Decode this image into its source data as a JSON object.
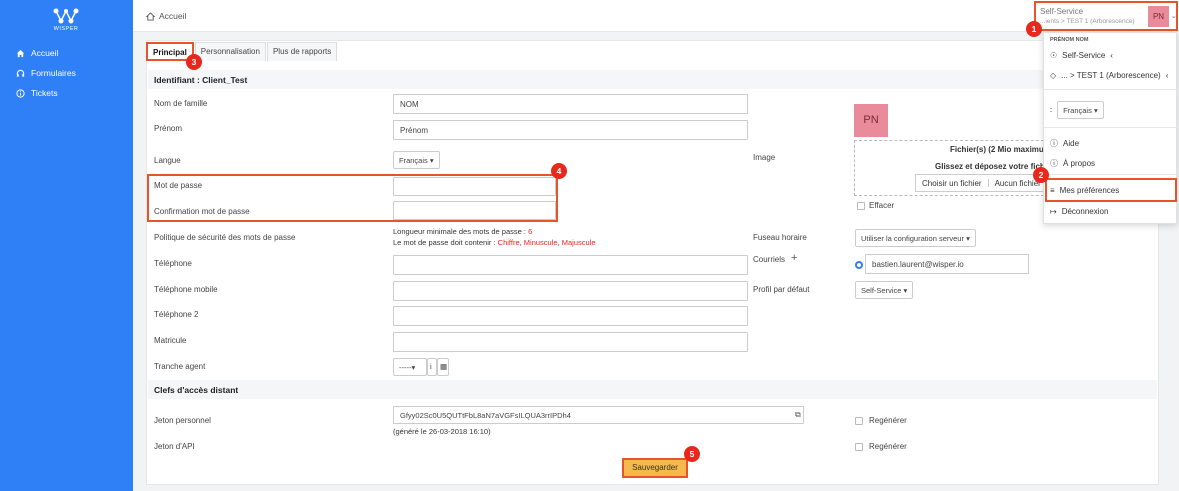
{
  "brand": {
    "logo_text": "WISPER"
  },
  "sidebar": {
    "items": [
      {
        "label": "Accueil",
        "icon": "home-icon"
      },
      {
        "label": "Formulaires",
        "icon": "headset-icon"
      },
      {
        "label": "Tickets",
        "icon": "info-circle-icon"
      }
    ]
  },
  "topbar": {
    "breadcrumb": "Accueil",
    "user_role": "Self-Service",
    "user_path": "...ients > TEST 1 (Arborescence)",
    "user_initials": "PN"
  },
  "tabs": [
    {
      "label": "Principal",
      "active": true
    },
    {
      "label": "Personnalisation",
      "active": false
    },
    {
      "label": "Plus de rapports",
      "active": false
    }
  ],
  "form": {
    "identifier_header": "Identifiant : Client_Test",
    "last_name": {
      "label": "Nom de famille",
      "value": "NOM"
    },
    "first_name": {
      "label": "Prénom",
      "value": "Prénom"
    },
    "language": {
      "label": "Langue",
      "value": "Français"
    },
    "password": {
      "label": "Mot de passe",
      "value": ""
    },
    "password_confirm": {
      "label": "Confirmation mot de passe",
      "value": ""
    },
    "password_policy": {
      "label": "Politique de sécurité des mots de passe",
      "min_length_text": "Longueur minimale des mots de passe :",
      "min_length_value": "6",
      "must_contain_text": "Le mot de passe doit contenir :",
      "req1": "Chiffre",
      "req2": "Minuscule",
      "req3": "Majuscule"
    },
    "phone": {
      "label": "Téléphone",
      "value": ""
    },
    "mobile": {
      "label": "Téléphone mobile",
      "value": ""
    },
    "phone2": {
      "label": "Téléphone 2",
      "value": ""
    },
    "matricule": {
      "label": "Matricule",
      "value": ""
    },
    "agent_slot": {
      "label": "Tranche agent",
      "value": "-----"
    },
    "image": {
      "label": "Image",
      "initials": "PN",
      "files_title": "Fichier(s) (2 Mio maximum)",
      "drop_text": "Glissez et déposez votre fichier",
      "choose_button": "Choisir un fichier",
      "no_file": "Aucun fichier choisi",
      "erase_label": "Effacer"
    },
    "timezone": {
      "label": "Fuseau horaire",
      "value": "Utiliser la configuration serveur"
    },
    "emails": {
      "label": "Courriels",
      "value": "bastien.laurent@wisper.io"
    },
    "default_profile": {
      "label": "Profil par défaut",
      "value": "Self-Service"
    },
    "remote_header": "Clefs d'accès distant",
    "personal_token": {
      "label": "Jeton personnel",
      "value": "Gfyy02Sc0U5QUTtFbL8aN7aVGFsILQUA3rrIPDh4",
      "generated": "(généré le 26-03-2018 16:10)",
      "regen_label": "Regénérer"
    },
    "api_token": {
      "label": "Jeton d'API",
      "regen_label": "Regénérer"
    },
    "save_label": "Sauvegarder"
  },
  "user_menu": {
    "name": "PRÉNOM NOM",
    "profile": "Self-Service",
    "entity": "... > TEST 1 (Arborescence)",
    "language": "Français",
    "help": "Aide",
    "about": "À propos",
    "preferences": "Mes préférences",
    "logout": "Déconnexion"
  },
  "badges": [
    "1",
    "2",
    "3",
    "4",
    "5"
  ],
  "colors": {
    "sidebar": "#2f80f7",
    "highlight": "#e8542a",
    "badge": "#e8281d",
    "save_button": "#f6b94a",
    "avatar": "#e98b9a"
  }
}
